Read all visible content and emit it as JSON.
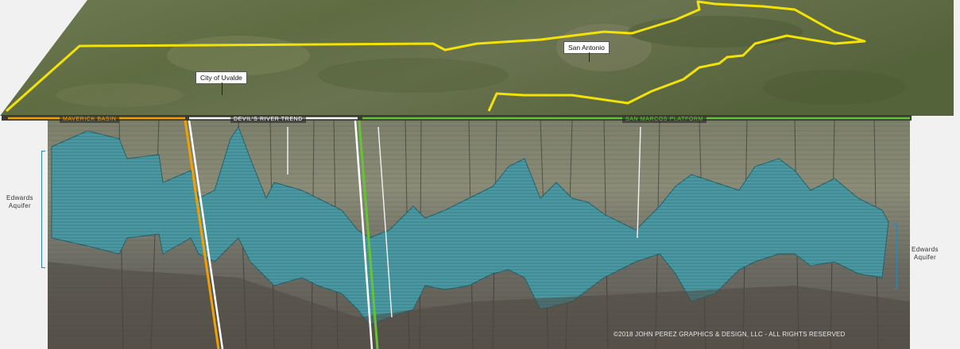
{
  "map": {
    "city_labels": {
      "uvalde": "City of Uvalde",
      "san_antonio": "San Antonio"
    },
    "boundary_color": "#f2e205"
  },
  "trends": {
    "maverick_basin": {
      "label": "MAVERICK BASIN",
      "color": "#f0a000"
    },
    "devils_river": {
      "label": "DEVIL'S RIVER TREND",
      "color": "#ffffff"
    },
    "san_marcos": {
      "label": "SAN MARCOS PLATFORM",
      "color": "#63c334"
    }
  },
  "aquifer": {
    "left_label": "Edwards\nAquifer",
    "right_label": "Edwards\nAquifer",
    "color": "#3f8d96"
  },
  "copyright": "©2018 JOHN PEREZ GRAPHICS & DESIGN, LLC - ALL RIGHTS RESERVED"
}
